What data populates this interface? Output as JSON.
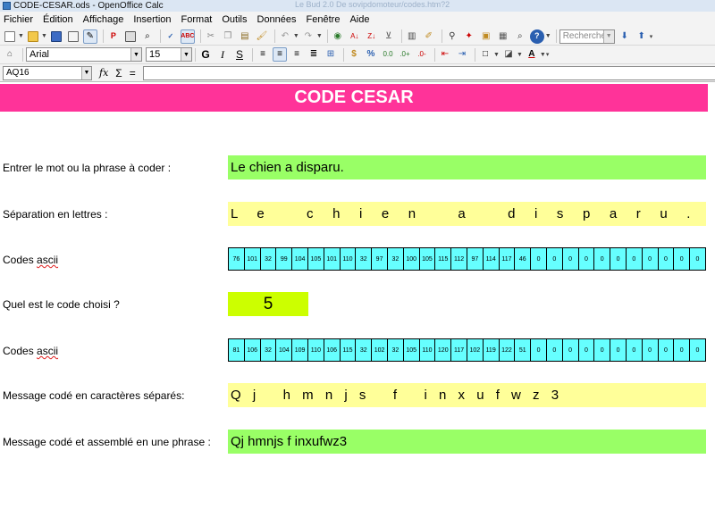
{
  "window": {
    "title": "CODE-CESAR.ods - OpenOffice Calc",
    "ghost_title": "Le Bud 2.0 De sovipdomoteur/codes.htm?2"
  },
  "menu": {
    "items": [
      "Fichier",
      "Édition",
      "Affichage",
      "Insertion",
      "Format",
      "Outils",
      "Données",
      "Fenêtre",
      "Aide"
    ]
  },
  "toolbar": {
    "search_placeholder": "Rechercher",
    "font_name": "Arial",
    "font_size": "15",
    "bold": "G",
    "italic": "I",
    "underline": "S"
  },
  "formula_bar": {
    "cell_reference": "AQ16",
    "fx_label": "fx",
    "sigma_label": "Σ",
    "equals_label": "="
  },
  "sheet": {
    "title": "CODE CESAR",
    "rows": {
      "input_label": "Entrer le mot ou la phrase à coder :",
      "input_value": "Le chien a disparu.",
      "separation_label": "Séparation en lettres :",
      "separation_value": "L e   c h i e n   a   d i s p a r u .",
      "ascii_label_prefix": "Codes ",
      "ascii_label_word": "ascii",
      "ascii_values": [
        "76",
        "101",
        "32",
        "99",
        "104",
        "105",
        "101",
        "110",
        "32",
        "97",
        "32",
        "100",
        "105",
        "115",
        "112",
        "97",
        "114",
        "117",
        "46",
        "0",
        "0",
        "0",
        "0",
        "0",
        "0",
        "0",
        "0",
        "0",
        "0",
        "0"
      ],
      "code_label": "Quel est le code choisi ?",
      "code_value": "5",
      "coded_ascii_label_prefix": "Codes ",
      "coded_ascii_label_word": "ascii",
      "coded_ascii_values": [
        "81",
        "106",
        "32",
        "104",
        "109",
        "110",
        "106",
        "115",
        "32",
        "102",
        "32",
        "105",
        "110",
        "120",
        "117",
        "102",
        "119",
        "122",
        "51",
        "0",
        "0",
        "0",
        "0",
        "0",
        "0",
        "0",
        "0",
        "0",
        "0",
        "0"
      ],
      "coded_sep_label": "Message codé en caractères séparés:",
      "coded_sep_value": "Q j   h m n j s   f   i n x u f w z 3",
      "coded_phrase_label": "Message codé et assemblé en une phrase :",
      "coded_phrase_value": "Qj hmnjs f inxufwz3"
    }
  },
  "colors": {
    "banner": "#ff3399",
    "green_cell": "#99ff66",
    "yellow_cell": "#ffff99",
    "ascii_cell": "#66ffff",
    "code_cell": "#ccff00"
  }
}
